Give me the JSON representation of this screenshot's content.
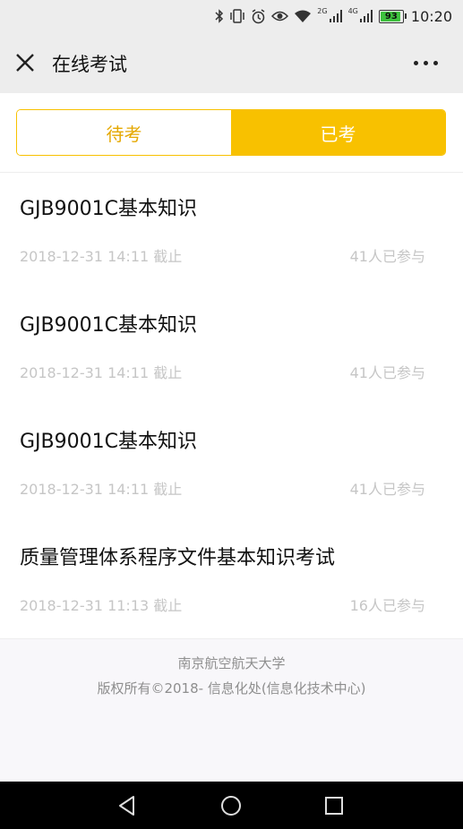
{
  "status_bar": {
    "signal_tag_1": "2G",
    "signal_tag_2": "4G",
    "battery": "93",
    "time": "10:20",
    "icons": [
      "bluetooth-icon",
      "vibrate-icon",
      "alarm-icon",
      "eye-icon",
      "wifi-icon",
      "signal-icon",
      "signal-icon",
      "battery-icon"
    ]
  },
  "navbar": {
    "title": "在线考试",
    "close_icon": "close-icon",
    "more_icon": "more-icon"
  },
  "tabs": {
    "pending": "待考",
    "done": "已考",
    "active": "done",
    "accent_color": "#f8c100"
  },
  "exams": [
    {
      "title": "GJB9001C基本知识",
      "deadline": "2018-12-31 14:11 截止",
      "participants": "41人已参与"
    },
    {
      "title": "GJB9001C基本知识",
      "deadline": "2018-12-31 14:11 截止",
      "participants": "41人已参与"
    },
    {
      "title": "GJB9001C基本知识",
      "deadline": "2018-12-31 14:11 截止",
      "participants": "41人已参与"
    },
    {
      "title": "质量管理体系程序文件基本知识考试",
      "deadline": "2018-12-31 11:13 截止",
      "participants": "16人已参与"
    }
  ],
  "footer": {
    "line1": "南京航空航天大学",
    "line2": "版权所有©2018- 信息化处(信息化技术中心)"
  },
  "system_nav": [
    "back-icon",
    "home-icon",
    "recents-icon"
  ]
}
